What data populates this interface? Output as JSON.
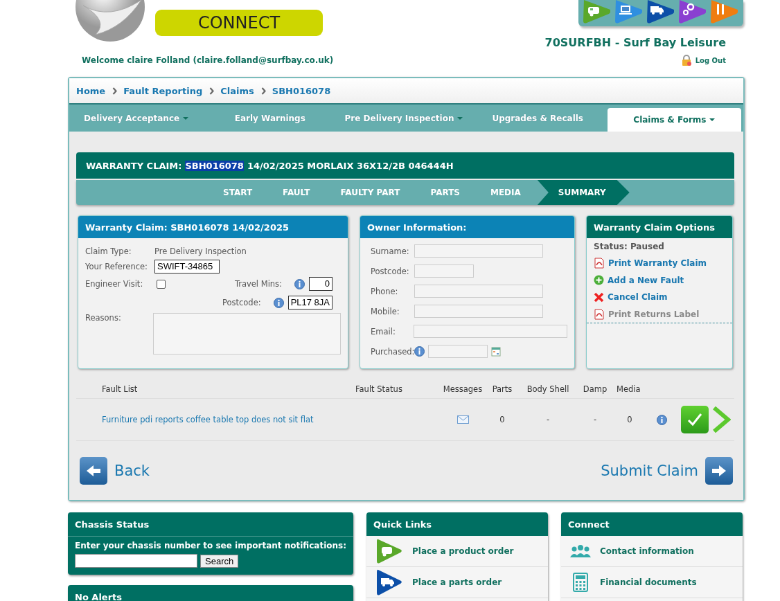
{
  "header": {
    "logo_text": "CONNECT",
    "welcome": "Welcome claire Folland (claire.folland@surfbay.co.uk)",
    "dealer": "70SURFBH - Surf Bay Leisure",
    "logout": "Log Out",
    "apps": [
      {
        "kind": "caravan",
        "color": "#5aa82a"
      },
      {
        "kind": "laptop",
        "color": "#2f8fe0"
      },
      {
        "kind": "truck",
        "color": "#0c4fa8"
      },
      {
        "kind": "gears",
        "color": "#8a3fd1"
      },
      {
        "kind": "tools",
        "color": "#ef7d10"
      }
    ]
  },
  "breadcrumb": [
    "Home",
    "Fault Reporting",
    "Claims",
    "SBH016078"
  ],
  "nav_tabs": [
    {
      "label": "Delivery Acceptance",
      "dropdown": true,
      "selected": false
    },
    {
      "label": "Early Warnings",
      "dropdown": false,
      "selected": false
    },
    {
      "label": "Pre Delivery Inspection",
      "dropdown": true,
      "selected": false
    },
    {
      "label": "Upgrades & Recalls",
      "dropdown": false,
      "selected": false
    },
    {
      "label": "Claims & Forms",
      "dropdown": true,
      "selected": true
    }
  ],
  "claim_header": {
    "prefix": "WARRANTY CLAIM:",
    "claim_no": "SBH016078",
    "claim_no_highlighted": true,
    "details": "14/02/2025 MORLAIX 36X12/2B 046444H"
  },
  "steps": [
    {
      "label": "START",
      "selected": false
    },
    {
      "label": "FAULT",
      "selected": false
    },
    {
      "label": "FAULTY PART",
      "selected": false
    },
    {
      "label": "PARTS",
      "selected": false
    },
    {
      "label": "MEDIA",
      "selected": false
    },
    {
      "label": "SUMMARY",
      "selected": true
    }
  ],
  "claim_card": {
    "title": "Warranty Claim: SBH016078 14/02/2025",
    "claim_type_label": "Claim Type:",
    "claim_type": "Pre Delivery Inspection",
    "reference_label": "Your Reference:",
    "reference": "SWIFT-34865",
    "engineer_visit_label": "Engineer Visit:",
    "engineer_visit": false,
    "travel_mins_label": "Travel Mins:",
    "travel_mins": "0",
    "postcode_label": "Postcode:",
    "postcode": "PL17 8JA",
    "reasons_label": "Reasons:"
  },
  "owner_card": {
    "title": "Owner Information:",
    "fields": [
      {
        "label": "Surname:",
        "kind": "text"
      },
      {
        "label": "Postcode:",
        "kind": "short"
      },
      {
        "label": "Phone:",
        "kind": "text"
      },
      {
        "label": "Mobile:",
        "kind": "text"
      },
      {
        "label": "Email:",
        "kind": "wide"
      },
      {
        "label": "Purchased:",
        "kind": "date"
      }
    ]
  },
  "options_card": {
    "title": "Warranty Claim Options",
    "status": "Status: Paused",
    "actions": [
      {
        "label": "Print Warranty Claim",
        "kind": "pdf",
        "disabled": false
      },
      {
        "label": "Add a New Fault",
        "kind": "add",
        "disabled": false
      },
      {
        "label": "Cancel Claim",
        "kind": "cancel",
        "disabled": false
      },
      {
        "label": "Print Returns Label",
        "kind": "pdf",
        "disabled": true
      }
    ]
  },
  "fault_table": {
    "columns": [
      "Fault List",
      "Fault Status",
      "Messages",
      "Parts",
      "Body Shell",
      "Damp",
      "Media"
    ],
    "rows": [
      {
        "fault": "Furniture pdi reports coffee table top does not sit flat",
        "parts": "0",
        "body_shell": "-",
        "damp": "-",
        "media": "0"
      }
    ]
  },
  "nav_buttons": {
    "back": "Back",
    "submit": "Submit Claim"
  },
  "footer": {
    "chassis": {
      "title": "Chassis Status",
      "prompt": "Enter your chassis number to see important notifications:",
      "button": "Search"
    },
    "alerts": {
      "title": "No Alerts"
    },
    "quick_links": {
      "title": "Quick Links",
      "items": [
        {
          "label": "Place a product order",
          "kind": "caravan"
        },
        {
          "label": "Place a parts order",
          "kind": "truck"
        }
      ]
    },
    "connect": {
      "title": "Connect",
      "items": [
        {
          "label": "Contact information",
          "kind": "people"
        },
        {
          "label": "Financial documents",
          "kind": "calculator"
        }
      ]
    }
  }
}
